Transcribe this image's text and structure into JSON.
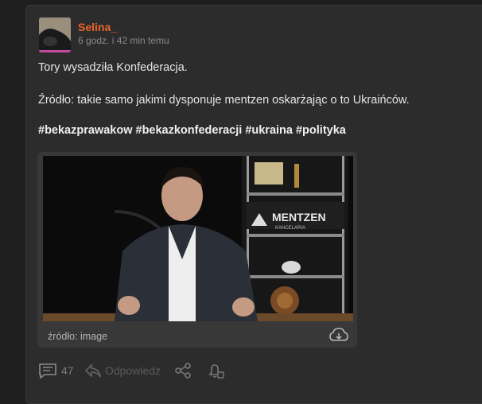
{
  "post": {
    "author": "Selina_",
    "time": "6 godz. i 42 min temu",
    "line1": "Tory wysadziła Konfederacja.",
    "line2": "Źródło: takie samo jakimi dysponuje mentzen oskarżając o to Ukraińców.",
    "tags": "#bekazprawakow #bekazkonfederacji #ukraina #polityka"
  },
  "embed": {
    "brand": "MENTZEN",
    "brand_sub": "KANCELARIA",
    "source_label": "źródło: image"
  },
  "actions": {
    "comments_count": "47",
    "reply_label": "Odpowiedz"
  },
  "colors": {
    "author": "#e8642c",
    "background": "#1e1e1e",
    "card": "#2c2c2c"
  }
}
